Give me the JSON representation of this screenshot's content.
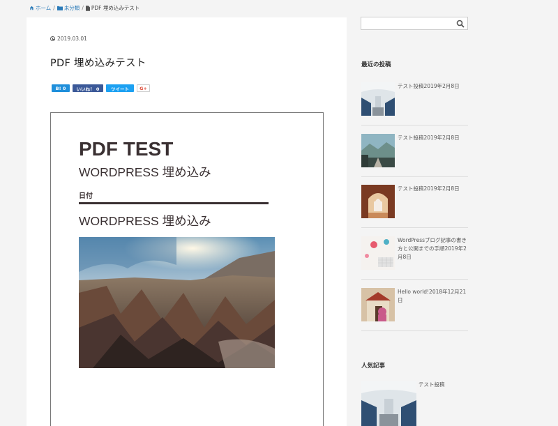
{
  "breadcrumb": {
    "home": "ホーム",
    "category": "未分類",
    "current": "PDF 埋め込みテスト"
  },
  "post": {
    "date": "2019.03.01",
    "title": "PDF 埋め込みテスト"
  },
  "share": {
    "hatena": "B! 0",
    "facebook": "いいね！ 0",
    "twitter": "ツイート",
    "google": "G+"
  },
  "pdf": {
    "title": "PDF TEST",
    "subtitle": "WORDPRESS 埋め込み",
    "date_label": "日付",
    "subtitle2": "WORDPRESS 埋め込み"
  },
  "sidebar": {
    "search_placeholder": "",
    "recent_heading": "最近の投稿",
    "recent_posts": [
      {
        "title": "テスト投稿2019年2月8日",
        "thumb": "airplane-cabin"
      },
      {
        "title": "テスト投稿2019年2月8日",
        "thumb": "mountain-road"
      },
      {
        "title": "テスト投稿2019年2月8日",
        "thumb": "taj-mahal-arch"
      },
      {
        "title": "WordPressブログ記事の書き方と公開までの手順2019年2月8日",
        "thumb": "desk-keyboard"
      },
      {
        "title": "Hello world!2018年12月21日",
        "thumb": "temple-woman"
      }
    ],
    "popular_heading": "人気記事",
    "popular_posts": [
      {
        "title": "テスト投稿",
        "thumb": "airplane-cabin"
      }
    ]
  },
  "colors": {
    "link": "#2a7ab8",
    "hatena": "#1f8fdb",
    "facebook": "#3b5998",
    "twitter": "#1da1f2",
    "google": "#dd4b39"
  }
}
